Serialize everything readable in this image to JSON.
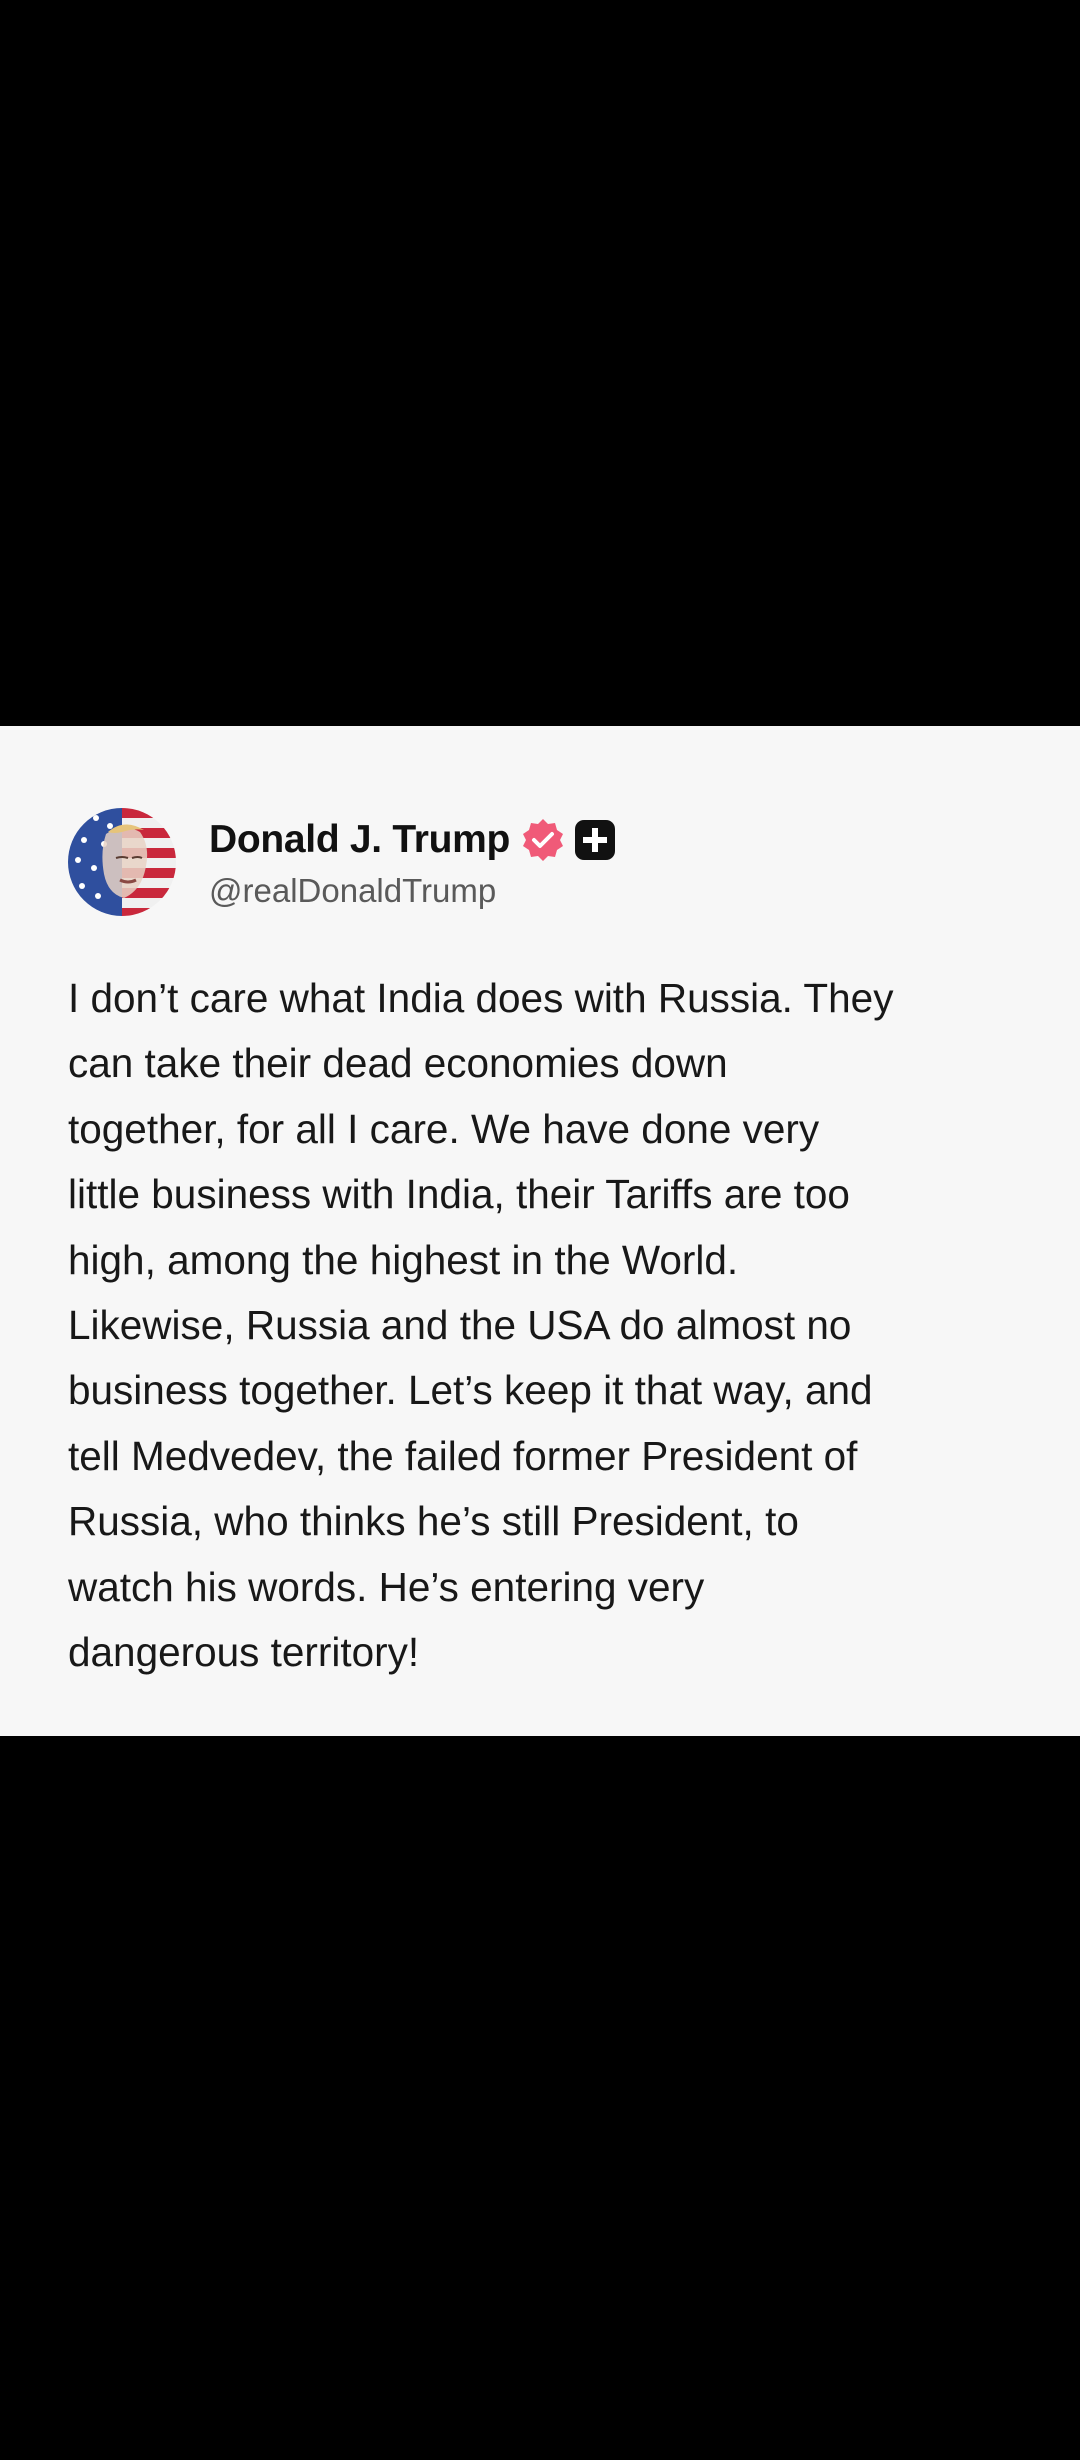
{
  "post": {
    "author": {
      "display_name": "Donald J. Trump",
      "handle": "@realDonaldTrump",
      "avatar": "flag-portrait-avatar",
      "verified_icon": "verified-badge-icon",
      "extra_icon": "plus-badge-icon"
    },
    "text": "I don’t care what India does with Russia. They\ncan take their dead economies down\ntogether, for all I care. We have done very\nlittle business with India, their Tariffs are too\nhigh, among the highest in the World.\nLikewise, Russia and the USA do almost no\nbusiness together. Let’s keep it that way, and\ntell Medvedev, the failed former President of\nRussia, who thinks he’s still President, to\nwatch his words. He’s entering very\ndangerous territory!"
  },
  "colors": {
    "background": "#000000",
    "card": "#f7f7f7",
    "text": "#181818",
    "handle": "#5a5a5a",
    "verified": "#f05a78",
    "plus_badge": "#111111"
  }
}
